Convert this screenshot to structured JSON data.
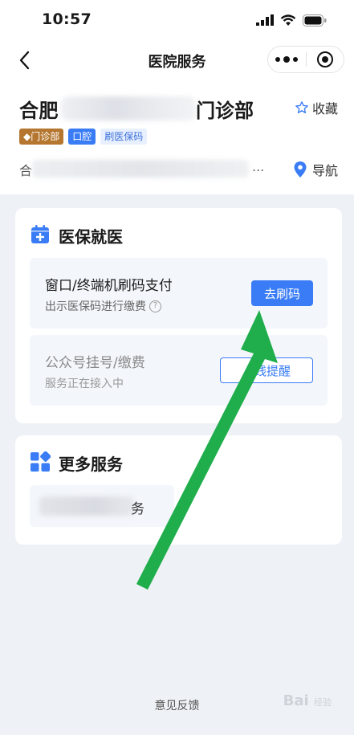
{
  "status_bar": {
    "time": "10:57"
  },
  "nav": {
    "title": "医院服务"
  },
  "hospital": {
    "name_prefix": "合肥",
    "name_suffix": "门诊部",
    "favorite_label": "收藏",
    "tags": [
      "门诊部",
      "口腔",
      "刷医保码"
    ],
    "address_prefix": "合",
    "address_ellipsis": "...",
    "navigate_label": "导航"
  },
  "insurance_card": {
    "title": "医保就医",
    "services": [
      {
        "title": "窗口/终端机刷码支付",
        "subtitle": "出示医保码进行缴费",
        "button": "去刷码"
      },
      {
        "title": "公众号挂号/缴费",
        "subtitle": "服务正在接入中",
        "button": "上线提醒"
      }
    ]
  },
  "more_card": {
    "title": "更多服务",
    "item_visible_char": "务"
  },
  "footer": {
    "feedback": "意见反馈"
  },
  "watermark": {
    "text": "Bai",
    "suffix": "经验"
  },
  "colors": {
    "primary": "#3a7cf5",
    "arrow": "#1fae4b",
    "tag_brown": "#b5772f"
  }
}
